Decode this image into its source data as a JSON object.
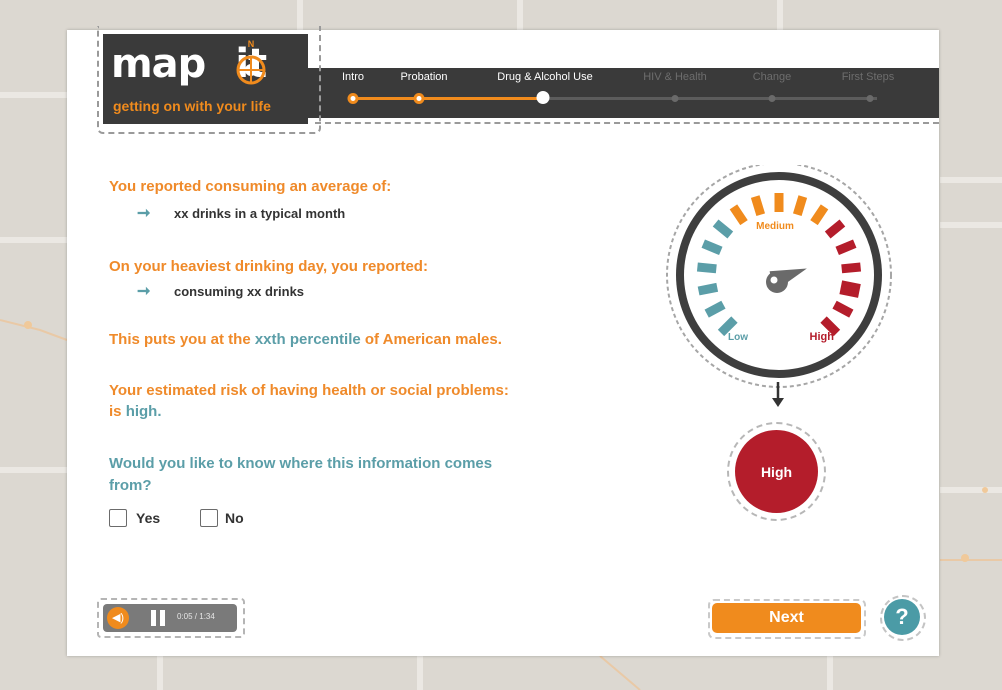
{
  "brand": {
    "name": "map",
    "name_end": "it",
    "compass_letter": "N",
    "tagline": "getting on with your life"
  },
  "steps": [
    {
      "label": "Intro",
      "state": "done"
    },
    {
      "label": "Probation",
      "state": "done"
    },
    {
      "label": "Drug & Alcohol Use",
      "state": "current"
    },
    {
      "label": "HIV & Health",
      "state": "todo"
    },
    {
      "label": "Change",
      "state": "todo"
    },
    {
      "label": "First Steps",
      "state": "todo"
    }
  ],
  "content": {
    "line1_heading": "You reported consuming an average of:",
    "line1_value": "xx drinks in a typical month",
    "line2_heading": "On your heaviest drinking day, you reported:",
    "line2_value": "consuming xx drinks",
    "percentile_prefix": "This puts you at the ",
    "percentile_value": "xxth percentile",
    "percentile_suffix": " of American males.",
    "risk_line1": "Your estimated risk of having health or social problems:",
    "risk_prefix": "is ",
    "risk_value": "high.",
    "question_line1": "Would you like to know where this information comes",
    "question_line2": "from?",
    "option_yes": "Yes",
    "option_no": "No"
  },
  "gauge": {
    "label_low": "Low",
    "label_medium": "Medium",
    "label_high": "High",
    "level": "High",
    "result_label": "High"
  },
  "player": {
    "time": "0:05 / 1:34"
  },
  "nav": {
    "next_label": "Next",
    "help_label": "?"
  },
  "colors": {
    "accent_orange": "#f08b1d",
    "teal": "#5b9ea8",
    "risk_red": "#b41d2b",
    "header_dark": "#3a3a3a"
  }
}
